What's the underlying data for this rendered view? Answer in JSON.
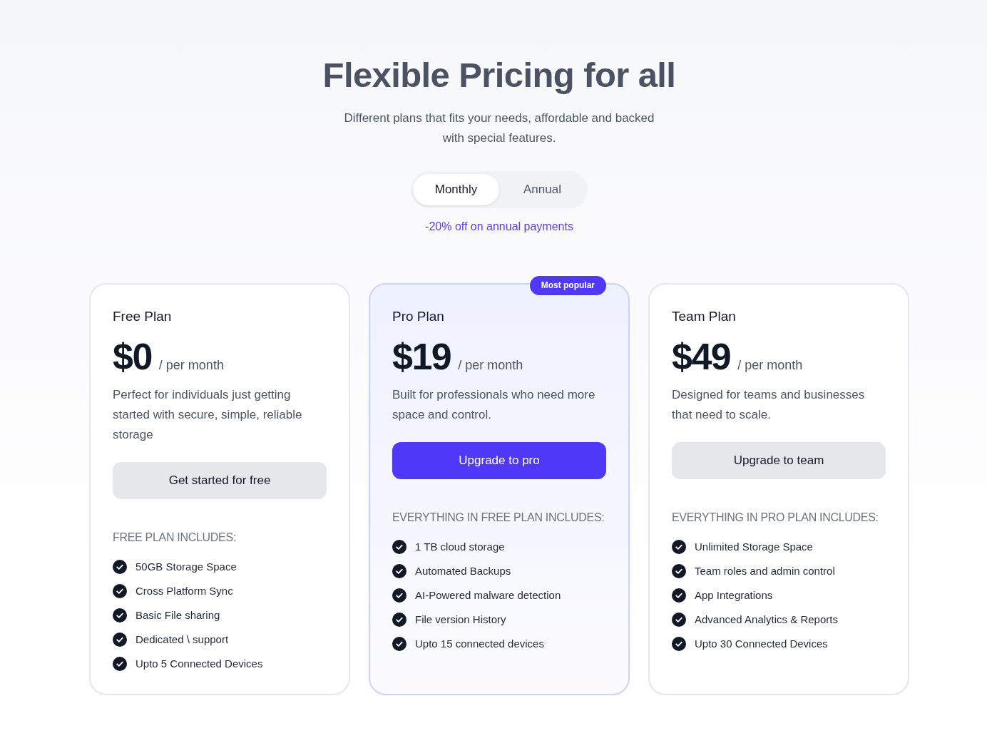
{
  "header": {
    "title": "Flexible Pricing for all",
    "subtitle": "Different plans that fits your needs, affordable and backed with special features."
  },
  "billing_toggle": {
    "options": [
      {
        "label": "Monthly",
        "selected": true
      },
      {
        "label": "Annual",
        "selected": false
      }
    ]
  },
  "discount_note": "-20% off on annual payments",
  "plans": [
    {
      "name": "Free Plan",
      "price": "$0",
      "period": "/ per month",
      "description": "Perfect for individuals just getting started with secure, simple, reliable storage",
      "featured": false,
      "button": {
        "label": "Get started for free",
        "kind": "secondary"
      },
      "features_title": "FREE PLAN INCLUDES:",
      "features": [
        "50GB Storage Space",
        "Cross Platform Sync",
        "Basic File sharing",
        "Dedicated \\ support",
        "Upto 5 Connected Devices"
      ]
    },
    {
      "name": "Pro Plan",
      "price": "$19",
      "period": "/ per month",
      "description": "Built for professionals who need more space and control.",
      "featured": true,
      "badge": "Most popular",
      "button": {
        "label": "Upgrade to pro",
        "kind": "primary"
      },
      "features_title": "EVERYTHING IN FREE PLAN INCLUDES:",
      "features": [
        "1 TB cloud storage",
        "Automated Backups",
        "AI-Powered malware detection",
        "File version History",
        "Upto 15 connected devices"
      ]
    },
    {
      "name": "Team Plan",
      "price": "$49",
      "period": "/ per month",
      "description": "Designed for teams and businesses that need to scale.",
      "featured": false,
      "button": {
        "label": "Upgrade to team",
        "kind": "secondary"
      },
      "features_title": "EVERYTHING IN PRO PLAN INCLUDES:",
      "features": [
        "Unlimited Storage Space",
        "Team roles and admin control",
        "App Integrations",
        "Advanced Analytics & Reports",
        "Upto 30 Connected Devices"
      ]
    }
  ]
}
